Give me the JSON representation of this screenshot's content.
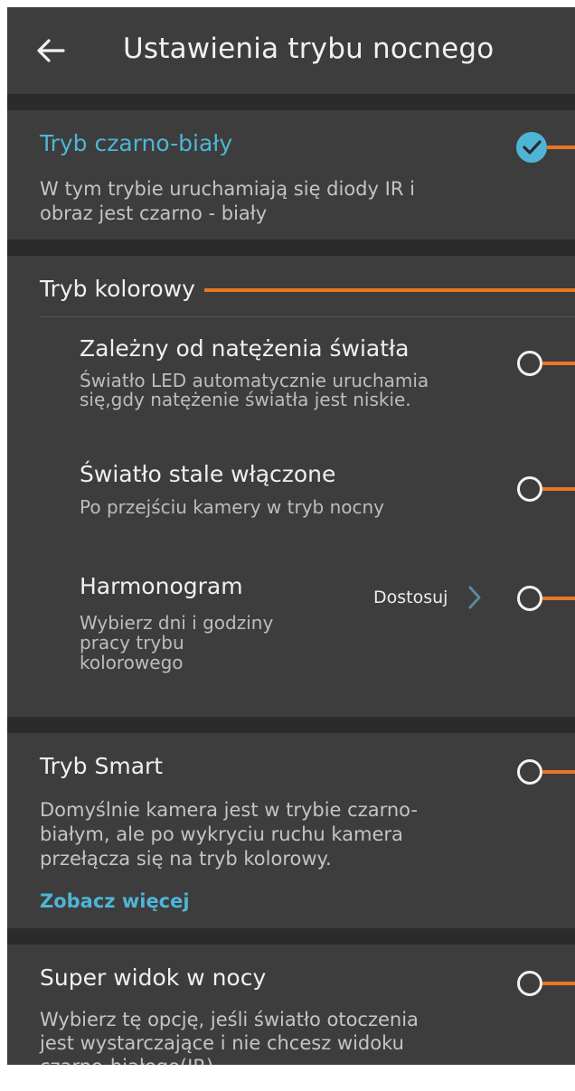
{
  "header": {
    "title": "Ustawienia trybu nocnego",
    "back_icon": "arrow-left-icon"
  },
  "options": {
    "black_white": {
      "title": "Tryb czarno-biały",
      "desc_lines": [
        "W tym trybie uruchamiają się diody IR i",
        "obraz jest czarno - biały"
      ],
      "selected": true
    },
    "color": {
      "title": "Tryb kolorowy",
      "suboptions": {
        "light_dependent": {
          "title": "Zależny od natężenia światła",
          "desc_lines": [
            "Światło LED automatycznie uruchamia",
            "się,gdy natężenie światła jest niskie."
          ],
          "selected": false
        },
        "always_on": {
          "title": "Światło stale włączone",
          "desc_lines": [
            "Po przejściu kamery w tryb nocny"
          ],
          "selected": false
        },
        "schedule": {
          "title": "Harmonogram",
          "desc_lines": [
            "Wybierz dni i godziny",
            "pracy trybu",
            "kolorowego"
          ],
          "action_label": "Dostosuj",
          "selected": false
        }
      }
    },
    "smart": {
      "title": "Tryb Smart",
      "desc_lines": [
        "Domyślnie kamera jest w trybie czarno-",
        "białym, ale po wykryciu ruchu kamera",
        "przełącza się na tryb kolorowy."
      ],
      "link": "Zobacz więcej",
      "selected": false
    },
    "super_night": {
      "title": "Super widok w nocy",
      "desc_lines": [
        "Wybierz tę opcję, jeśli światło otoczenia",
        "jest wystarczające i nie chcesz widoku",
        "czarno-białego(IR),"
      ],
      "selected": false
    }
  },
  "colors": {
    "accent": "#4fb5d6",
    "annotation": "#e77722",
    "background": "#2b2b2b",
    "card": "#3d3d3d"
  }
}
